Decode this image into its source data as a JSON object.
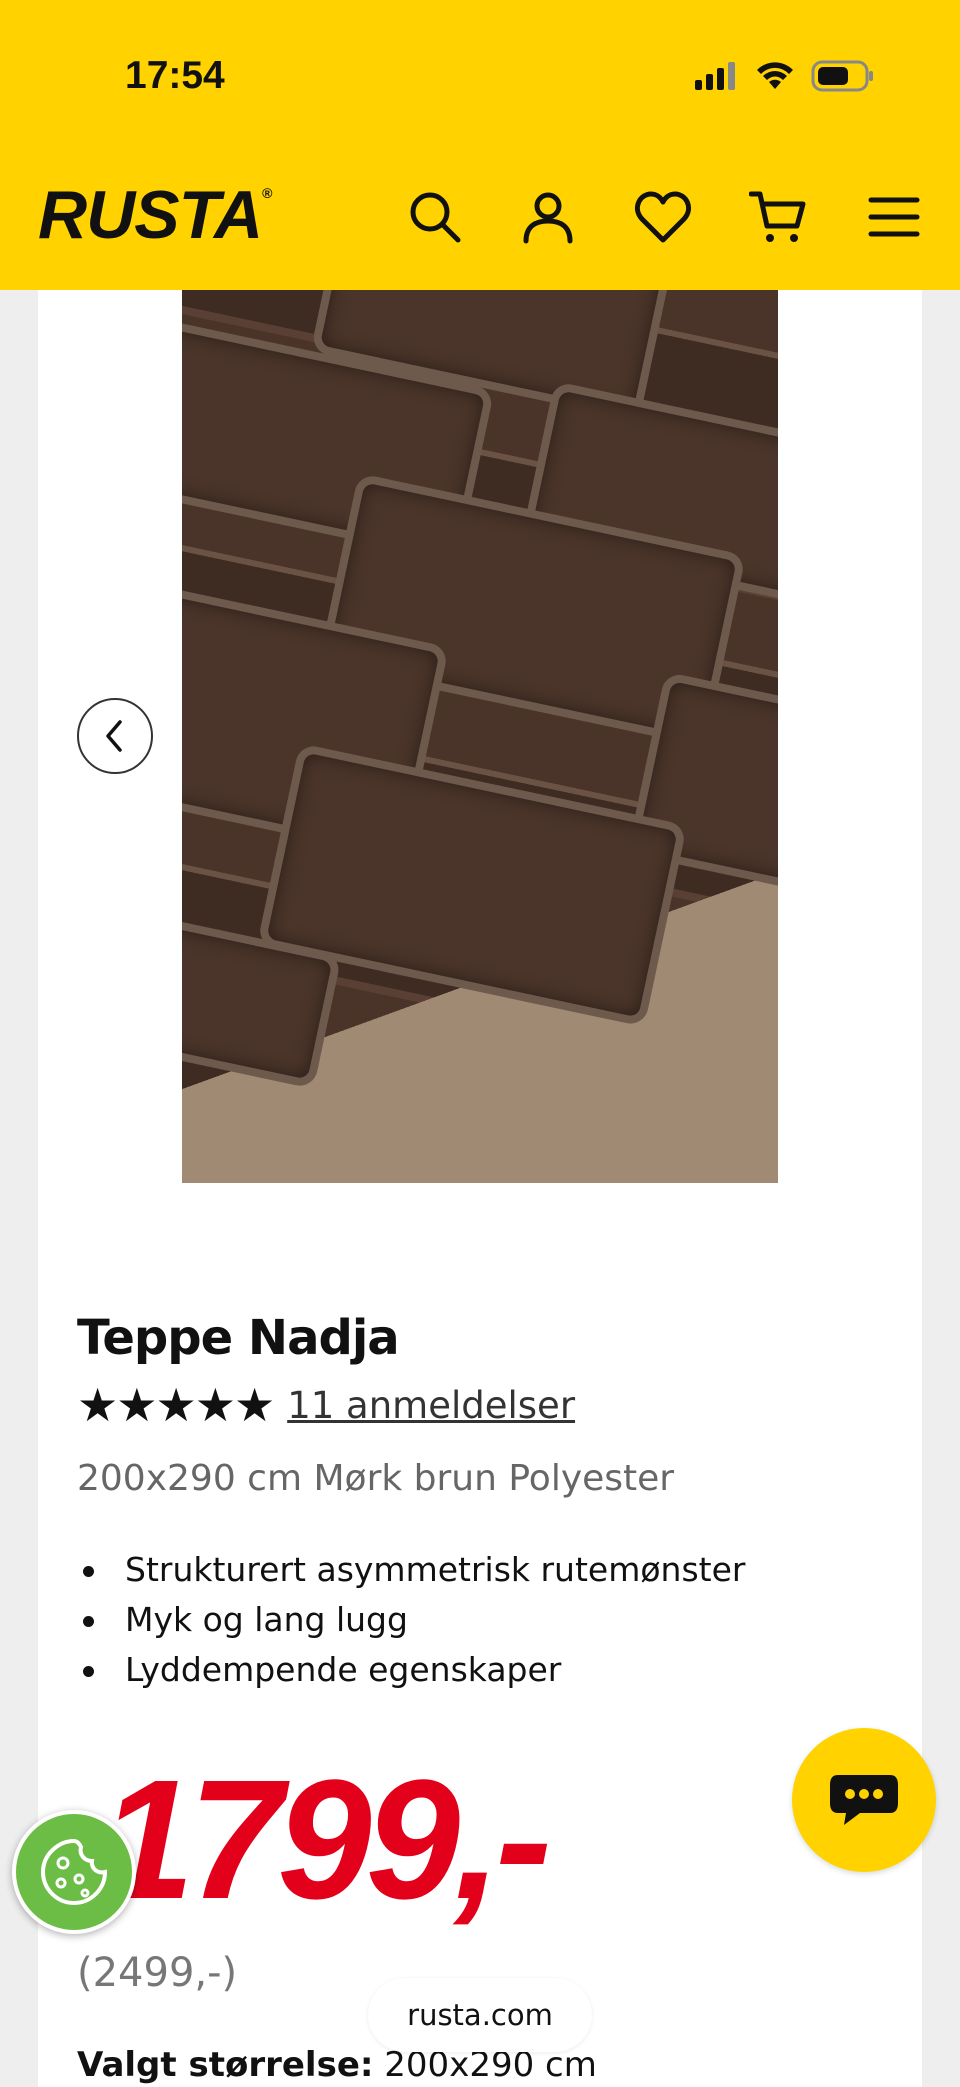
{
  "status_bar": {
    "time": "17:54"
  },
  "header": {
    "logo": "RUSTA",
    "logo_mark": "®",
    "icons": [
      "search-icon",
      "account-icon",
      "heart-icon",
      "cart-icon",
      "menu-icon"
    ]
  },
  "product": {
    "title": "Teppe Nadja",
    "rating_stars": "★★★★★",
    "rating": 5,
    "reviews_link": "11 anmeldelser",
    "subtitle": "200x290 cm Mørk brun Polyester",
    "features": [
      "Strukturert asymmetrisk rutemønster",
      "Myk og lang lugg",
      "Lyddempende egenskaper"
    ],
    "price": "1799,-",
    "old_price": "(2499,-)",
    "selected_size_label": "Valgt størrelse:",
    "selected_size_value": "200x290 cm"
  },
  "browser": {
    "url": "rusta.com"
  },
  "colors": {
    "brand_yellow": "#FFD200",
    "price_red": "#E3001B",
    "cookie_green": "#6cbd45"
  }
}
